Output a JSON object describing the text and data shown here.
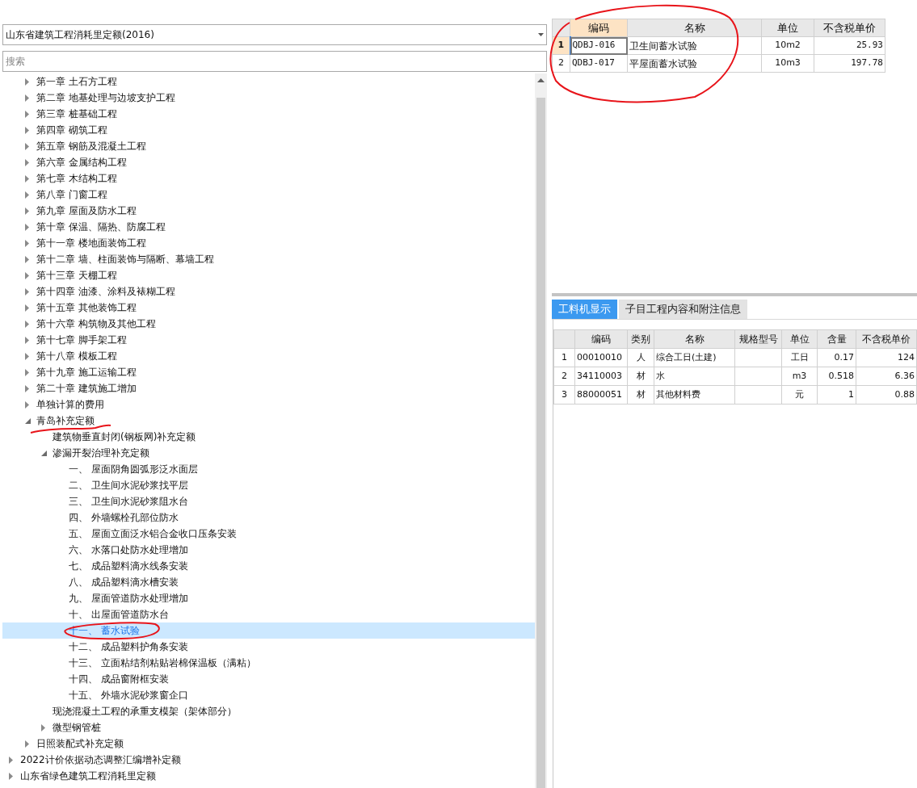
{
  "quota_selector": {
    "value": "山东省建筑工程消耗里定额(2016)"
  },
  "search": {
    "placeholder": "搜索"
  },
  "tree": [
    {
      "children": [
        {
          "label": "第一章 土石方工程",
          "expanded": false,
          "selected": false
        },
        {
          "label": "第二章 地基处理与边坡支护工程",
          "expanded": false,
          "selected": false
        },
        {
          "label": "第三章 桩基础工程",
          "expanded": false,
          "selected": false
        },
        {
          "label": "第四章 砌筑工程",
          "expanded": false,
          "selected": false
        },
        {
          "label": "第五章 钢筋及混凝土工程",
          "expanded": false,
          "selected": false
        },
        {
          "label": "第六章 金属结构工程",
          "expanded": false,
          "selected": false
        },
        {
          "label": "第七章 木结构工程",
          "expanded": false,
          "selected": false
        },
        {
          "label": "第八章 门窗工程",
          "expanded": false,
          "selected": false
        },
        {
          "label": "第九章 屋面及防水工程",
          "expanded": false,
          "selected": false
        },
        {
          "label": "第十章 保温、隔热、防腐工程",
          "expanded": false,
          "selected": false
        },
        {
          "label": "第十一章 楼地面装饰工程",
          "expanded": false,
          "selected": false
        },
        {
          "label": "第十二章 墙、柱面装饰与隔断、幕墙工程",
          "expanded": false,
          "selected": false
        },
        {
          "label": "第十三章 天棚工程",
          "expanded": false,
          "selected": false
        },
        {
          "label": "第十四章 油漆、涂料及裱糊工程",
          "expanded": false,
          "selected": false
        },
        {
          "label": "第十五章 其他装饰工程",
          "expanded": false,
          "selected": false
        },
        {
          "label": "第十六章 构筑物及其他工程",
          "expanded": false,
          "selected": false
        },
        {
          "label": "第十七章 脚手架工程",
          "expanded": false,
          "selected": false
        },
        {
          "label": "第十八章 模板工程",
          "expanded": false,
          "selected": false
        },
        {
          "label": "第十九章 施工运输工程",
          "expanded": false,
          "selected": false
        },
        {
          "label": "第二十章 建筑施工增加",
          "expanded": false,
          "selected": false
        },
        {
          "label": "单独计算的费用",
          "expanded": false,
          "selected": false
        },
        {
          "label": "青岛补充定额",
          "expanded": true,
          "selected": false,
          "children": [
            {
              "label": "建筑物垂直封闭(钢板网)补充定额",
              "selected": false
            },
            {
              "label": "渗漏开裂治理补充定额",
              "expanded": true,
              "selected": false,
              "children": [
                {
                  "label": "一、 屋面阴角圆弧形泛水面层",
                  "selected": false
                },
                {
                  "label": "二、 卫生间水泥砂浆找平层",
                  "selected": false
                },
                {
                  "label": "三、 卫生间水泥砂浆阻水台",
                  "selected": false
                },
                {
                  "label": "四、 外墙螺栓孔部位防水",
                  "selected": false
                },
                {
                  "label": "五、 屋面立面泛水铝合金收口压条安装",
                  "selected": false
                },
                {
                  "label": "六、 水落口处防水处理增加",
                  "selected": false
                },
                {
                  "label": "七、 成品塑料滴水线条安装",
                  "selected": false
                },
                {
                  "label": "八、 成品塑料滴水槽安装",
                  "selected": false
                },
                {
                  "label": "九、 屋面管道防水处理增加",
                  "selected": false
                },
                {
                  "label": "十、 出屋面管道防水台",
                  "selected": false
                },
                {
                  "label": "十一、 蓄水试验",
                  "selected": true
                },
                {
                  "label": "十二、 成品塑料护角条安装",
                  "selected": false
                },
                {
                  "label": "十三、 立面粘结剂粘贴岩棉保温板（满粘）",
                  "selected": false
                },
                {
                  "label": "十四、 成品窗附框安装",
                  "selected": false
                },
                {
                  "label": "十五、 外墙水泥砂浆窗企口",
                  "selected": false
                }
              ]
            },
            {
              "label": "现浇混凝土工程的承重支模架（架体部分）",
              "selected": false
            },
            {
              "label": "微型钢管桩",
              "expanded": false,
              "selected": false
            }
          ]
        },
        {
          "label": "日照装配式补充定额",
          "expanded": false,
          "selected": false
        }
      ]
    },
    {
      "label": "2022计价依据动态调整汇编增补定额",
      "expanded": false,
      "selected": false
    },
    {
      "label": "山东省绿色建筑工程消耗里定额",
      "expanded": false,
      "selected": false
    }
  ],
  "quota_table": {
    "columns": [
      {
        "label": "编码",
        "selected": true
      },
      {
        "label": "名称",
        "selected": false
      },
      {
        "label": "单位",
        "selected": false
      },
      {
        "label": "不含税单价",
        "selected": false
      }
    ],
    "rows": [
      {
        "number": "1",
        "selected": true,
        "cells": [
          "QDBJ-016",
          "卫生间蓄水试验",
          "10m2",
          "25.93"
        ]
      },
      {
        "number": "2",
        "selected": false,
        "cells": [
          "QDBJ-017",
          "平屋面蓄水试验",
          "10m3",
          "197.78"
        ]
      }
    ]
  },
  "tabs": [
    {
      "label": "工料机显示",
      "selected": true
    },
    {
      "label": "子目工程内容和附注信息",
      "selected": false
    }
  ],
  "resource_table": {
    "columns": [
      "编码",
      "类别",
      "名称",
      "规格型号",
      "单位",
      "含量",
      "不含税单价"
    ],
    "rows": [
      {
        "number": "1",
        "cells": [
          "00010010",
          "人",
          "综合工日(土建)",
          "",
          "工日",
          "0.17",
          "124"
        ]
      },
      {
        "number": "2",
        "cells": [
          "34110003",
          "材",
          "水",
          "",
          "m3",
          "0.518",
          "6.36"
        ]
      },
      {
        "number": "3",
        "cells": [
          "88000051",
          "材",
          "其他材料费",
          "",
          "元",
          "1",
          "0.88"
        ]
      }
    ]
  }
}
